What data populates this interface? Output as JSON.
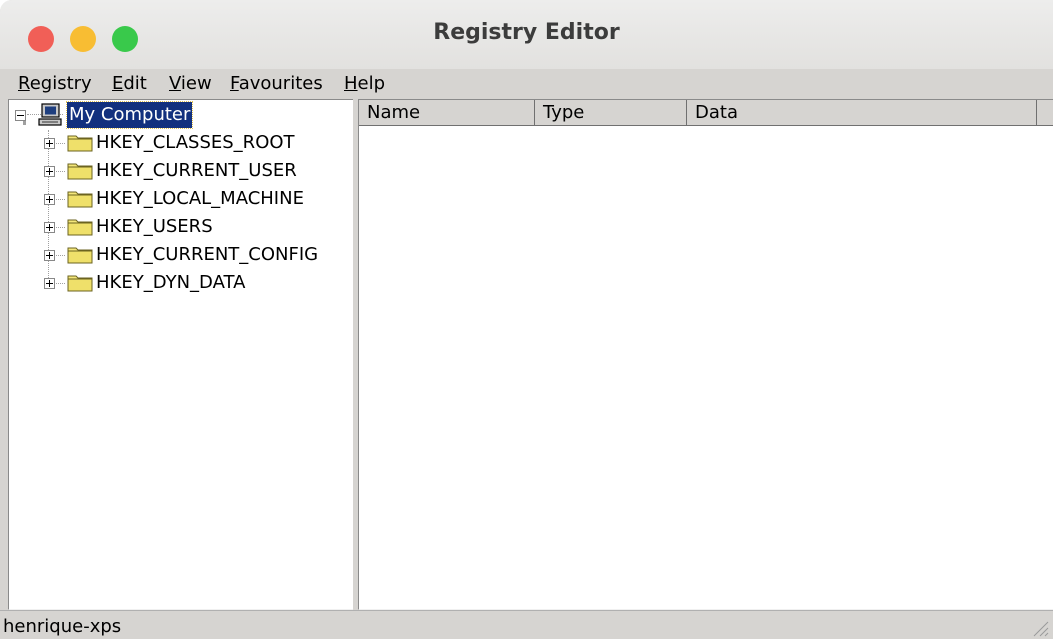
{
  "window": {
    "title": "Registry Editor"
  },
  "menu": [
    {
      "mnemonic": "R",
      "rest": "egistry"
    },
    {
      "mnemonic": "E",
      "rest": "dit"
    },
    {
      "mnemonic": "V",
      "rest": "iew"
    },
    {
      "mnemonic": "F",
      "rest": "avourites"
    },
    {
      "mnemonic": "H",
      "rest": "elp"
    }
  ],
  "tree": {
    "root": {
      "label": "My Computer",
      "icon": "computer-icon",
      "expanded": true,
      "selected": true
    },
    "keys": [
      {
        "label": "HKEY_CLASSES_ROOT"
      },
      {
        "label": "HKEY_CURRENT_USER"
      },
      {
        "label": "HKEY_LOCAL_MACHINE"
      },
      {
        "label": "HKEY_USERS"
      },
      {
        "label": "HKEY_CURRENT_CONFIG"
      },
      {
        "label": "HKEY_DYN_DATA"
      }
    ]
  },
  "list": {
    "columns": [
      "Name",
      "Type",
      "Data"
    ]
  },
  "status": {
    "text": "henrique-xps"
  },
  "colors": {
    "selection": "#12307e",
    "chrome": "#d6d4d1",
    "close": "#f15f57",
    "minimize": "#f8bd33",
    "maximize": "#39c94b",
    "folder": "#f4e77a"
  }
}
